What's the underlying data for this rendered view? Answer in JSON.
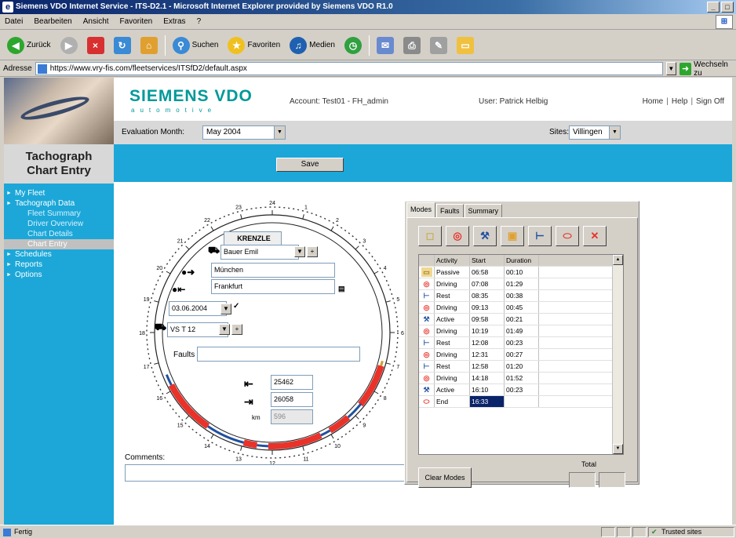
{
  "browser": {
    "title": "Siemens VDO Internet Service - ITS-D2.1 - Microsoft Internet Explorer provided by Siemens VDO R1.0",
    "menu": [
      "Datei",
      "Bearbeiten",
      "Ansicht",
      "Favoriten",
      "Extras",
      "?"
    ],
    "toolbar": {
      "back": "Zurück",
      "search": "Suchen",
      "favorites": "Favoriten",
      "media": "Medien"
    },
    "address_label": "Adresse",
    "address_url": "https://www.vry-fis.com/fleetservices/ITSfD2/default.aspx",
    "go_label": "Wechseln zu",
    "status_text": "Fertig",
    "zone_text": "Trusted sites"
  },
  "header": {
    "logo": "SIEMENS VDO",
    "logo_sub": "automotive",
    "account": "Account: Test01 - FH_admin",
    "user": "User: Patrick Helbig",
    "links": [
      "Home",
      "Help",
      "Sign Off"
    ]
  },
  "evalbar": {
    "label": "Evaluation Month:",
    "month": "May 2004",
    "sites_label": "Sites:",
    "site": "Villingen"
  },
  "sidebar": {
    "title_line1": "Tachograph",
    "title_line2": "Chart Entry",
    "items": [
      {
        "label": "My Fleet",
        "level": "top"
      },
      {
        "label": "Tachograph Data",
        "level": "top"
      },
      {
        "label": "Fleet Summary",
        "level": "sub"
      },
      {
        "label": "Driver Overview",
        "level": "sub"
      },
      {
        "label": "Chart Details",
        "level": "sub"
      },
      {
        "label": "Chart Entry",
        "level": "sub-active"
      },
      {
        "label": "Schedules",
        "level": "top"
      },
      {
        "label": "Reports",
        "level": "top"
      },
      {
        "label": "Options",
        "level": "top"
      }
    ]
  },
  "save_label": "Save",
  "disc": {
    "driver_label": "KRENZLE",
    "driver_value": "Bauer Emil",
    "from": "München",
    "to": "Frankfurt",
    "date": "03.06.2004",
    "vehicle": "VS T 12",
    "faults_label": "Faults",
    "odo_start": "25462",
    "odo_end": "26058",
    "km_label": "km",
    "km_value": "596",
    "hour_labels": [
      "24",
      "1",
      "2",
      "3",
      "4",
      "5",
      "6",
      "7",
      "8",
      "9",
      "10",
      "11",
      "12",
      "13",
      "14",
      "15",
      "16",
      "17",
      "18",
      "19",
      "20",
      "21",
      "22",
      "23"
    ]
  },
  "comments_label": "Comments:",
  "panel": {
    "tabs": [
      "Modes",
      "Faults",
      "Summary"
    ],
    "columns": [
      "Activity",
      "Start",
      "Duration"
    ],
    "rows": [
      {
        "icon": "passive-icon",
        "activity": "Passive",
        "start": "06:58",
        "duration": "00:10"
      },
      {
        "icon": "driving-icon",
        "activity": "Driving",
        "start": "07:08",
        "duration": "01:29"
      },
      {
        "icon": "rest-icon",
        "activity": "Rest",
        "start": "08:35",
        "duration": "00:38"
      },
      {
        "icon": "driving-icon",
        "activity": "Driving",
        "start": "09:13",
        "duration": "00:45"
      },
      {
        "icon": "active-icon",
        "activity": "Active",
        "start": "09:58",
        "duration": "00:21"
      },
      {
        "icon": "driving-icon",
        "activity": "Driving",
        "start": "10:19",
        "duration": "01:49"
      },
      {
        "icon": "rest-icon",
        "activity": "Rest",
        "start": "12:08",
        "duration": "00:23"
      },
      {
        "icon": "driving-icon",
        "activity": "Driving",
        "start": "12:31",
        "duration": "00:27"
      },
      {
        "icon": "rest-icon",
        "activity": "Rest",
        "start": "12:58",
        "duration": "01:20"
      },
      {
        "icon": "driving-icon",
        "activity": "Driving",
        "start": "14:18",
        "duration": "01:52"
      },
      {
        "icon": "active-icon",
        "activity": "Active",
        "start": "16:10",
        "duration": "00:23"
      },
      {
        "icon": "end-icon",
        "activity": "End",
        "start": "16:33",
        "duration": ""
      }
    ],
    "clear_label": "Clear Modes",
    "total_label": "Total"
  },
  "colors": {
    "accent": "#1ca7d8",
    "driving": "#e8322a",
    "logo": "#009999"
  }
}
